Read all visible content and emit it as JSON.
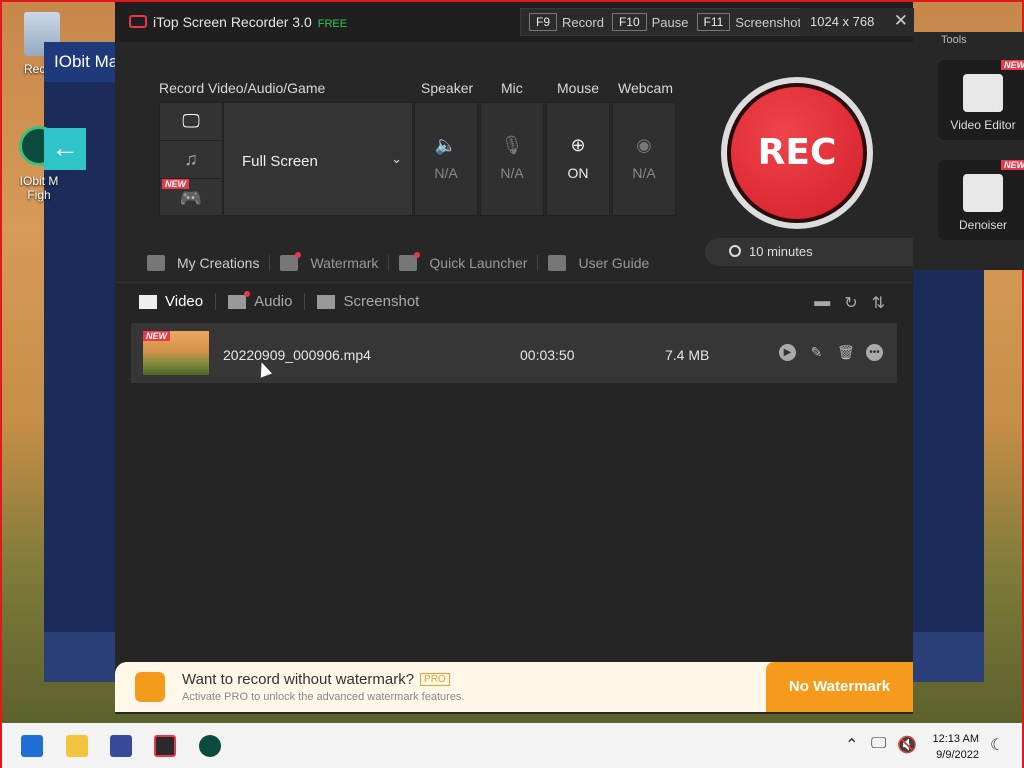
{
  "desktop": {
    "recycle_label": "Recycl",
    "iobit_label_1": "IObit M",
    "iobit_label_2": "Figh",
    "bg_window_title": "IObit Ma"
  },
  "app": {
    "title": "iTop Screen Recorder 3.0",
    "free_badge": "FREE",
    "hotkeys": [
      {
        "key": "F9",
        "label": "Record"
      },
      {
        "key": "F10",
        "label": "Pause"
      },
      {
        "key": "F11",
        "label": "Screenshot"
      }
    ],
    "resolution": "1024 x 768",
    "close_glyph": "✕"
  },
  "record": {
    "section_label": "Record Video/Audio/Game",
    "mode_value": "Full Screen",
    "new_tag": "NEW",
    "devices": [
      {
        "label": "Speaker",
        "value": "N/A",
        "icon": "speaker-icon",
        "glyph": "🔈"
      },
      {
        "label": "Mic",
        "value": "N/A",
        "icon": "mic-icon",
        "glyph": "🎙"
      },
      {
        "label": "Mouse",
        "value": "ON",
        "icon": "mouse-icon",
        "glyph": "⊕"
      },
      {
        "label": "Webcam",
        "value": "N/A",
        "icon": "webcam-icon",
        "glyph": "◉"
      }
    ],
    "rec_label": "REC",
    "timer": "10 minutes"
  },
  "toolrow": [
    {
      "label": "My Creations",
      "icon": "creations-icon"
    },
    {
      "label": "Watermark",
      "icon": "watermark-icon"
    },
    {
      "label": "Quick Launcher",
      "icon": "launcher-icon"
    },
    {
      "label": "User Guide",
      "icon": "guide-icon"
    }
  ],
  "tabs": [
    {
      "label": "Video",
      "icon": "video-icon"
    },
    {
      "label": "Audio",
      "icon": "audio-icon"
    },
    {
      "label": "Screenshot",
      "icon": "screenshot-icon"
    }
  ],
  "files": [
    {
      "name": "20220909_000906.mp4",
      "duration": "00:03:50",
      "size": "7.4 MB",
      "tag": "NEW"
    }
  ],
  "promo": {
    "title": "Want to record without watermark?",
    "pro": "PRO",
    "subtitle": "Activate PRO to unlock the advanced watermark features.",
    "button": "No Watermark"
  },
  "tools": {
    "title": "Tools",
    "items": [
      {
        "label": "Video Editor",
        "tag": "NEW"
      },
      {
        "label": "Denoiser",
        "tag": "NEW"
      }
    ]
  },
  "taskbar": {
    "time": "12:13 AM",
    "date": "9/9/2022"
  },
  "colors": {
    "accent_red": "#e8394a",
    "accent_orange": "#f59a1a",
    "free_green": "#39c15a"
  }
}
